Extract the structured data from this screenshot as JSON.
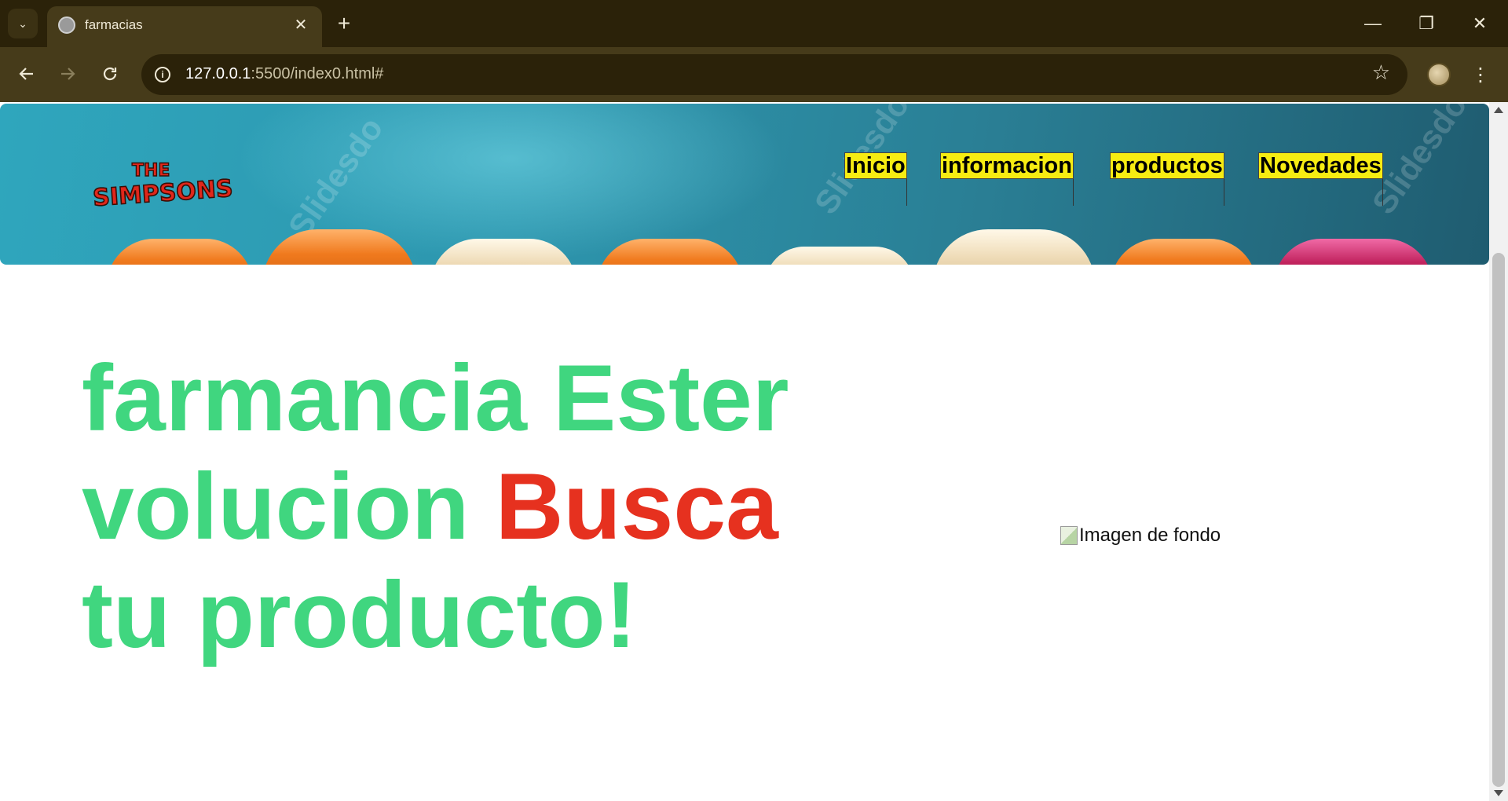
{
  "browser": {
    "tab_title": "farmacias",
    "tab_close": "✕",
    "new_tab": "+",
    "url_host": "127.0.0.1",
    "url_path": ":5500/index0.html#",
    "window_controls": {
      "minimize": "—",
      "restore": "❐",
      "close": "✕"
    },
    "icons": [
      "tab-search-icon",
      "globe-icon",
      "back-arrow-icon",
      "forward-arrow-icon",
      "reload-icon",
      "site-info-icon",
      "star-icon",
      "profile-avatar-icon",
      "kebab-menu-icon"
    ]
  },
  "page": {
    "stray_text": "· · ·  ·",
    "logo_text_top": "THE",
    "logo_text_main": "SIMPSONS",
    "nav": [
      {
        "label": "Inicio"
      },
      {
        "label": "informacion"
      },
      {
        "label": "productos"
      },
      {
        "label": "Novedades"
      }
    ],
    "hero": {
      "line1": "farmancia Ester",
      "line2_a": "volucion ",
      "line2_b": "Busca",
      "line3": "tu producto!"
    },
    "image_alt": "Imagen de fondo",
    "colors": {
      "hero_green": "#40d67f",
      "hero_red": "#e6311f",
      "nav_bg": "#f7ec12",
      "header_teal": "#2d96ae",
      "chrome_dark": "#2b2209",
      "chrome_toolbar": "#463b1a"
    }
  }
}
